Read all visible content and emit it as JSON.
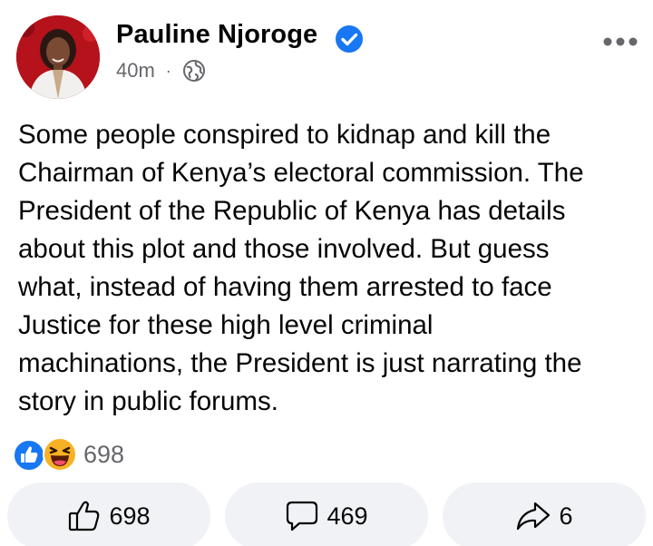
{
  "post": {
    "author": {
      "name": "Pauline Njoroge",
      "verified": true,
      "avatar_icon": "profile-photo"
    },
    "timestamp": "40m",
    "separator": "·",
    "audience_icon": "globe-icon",
    "more_icon": "more-options-icon",
    "text": "Some people conspired to kidnap and kill the\nChairman of Kenya’s electoral commission. The\nPresident of the Republic of Kenya has details\nabout this plot and those involved. But guess\nwhat, instead of having them arrested to face\nJustice for these high level criminal\nmachinations, the President is just narrating the\nstory in public forums."
  },
  "reactions": {
    "icons": [
      "like-reaction-icon",
      "haha-reaction-icon"
    ],
    "count": "698"
  },
  "actions": {
    "like": {
      "icon": "thumbs-up-icon",
      "count": "698"
    },
    "comment": {
      "icon": "comment-bubble-icon",
      "count": "469"
    },
    "share": {
      "icon": "share-arrow-icon",
      "count": "6"
    }
  },
  "colors": {
    "verified_blue": "#1877f2",
    "secondary_text": "#65676b",
    "button_background": "#f0f2f5",
    "haha_yellow": "#f7b125"
  }
}
